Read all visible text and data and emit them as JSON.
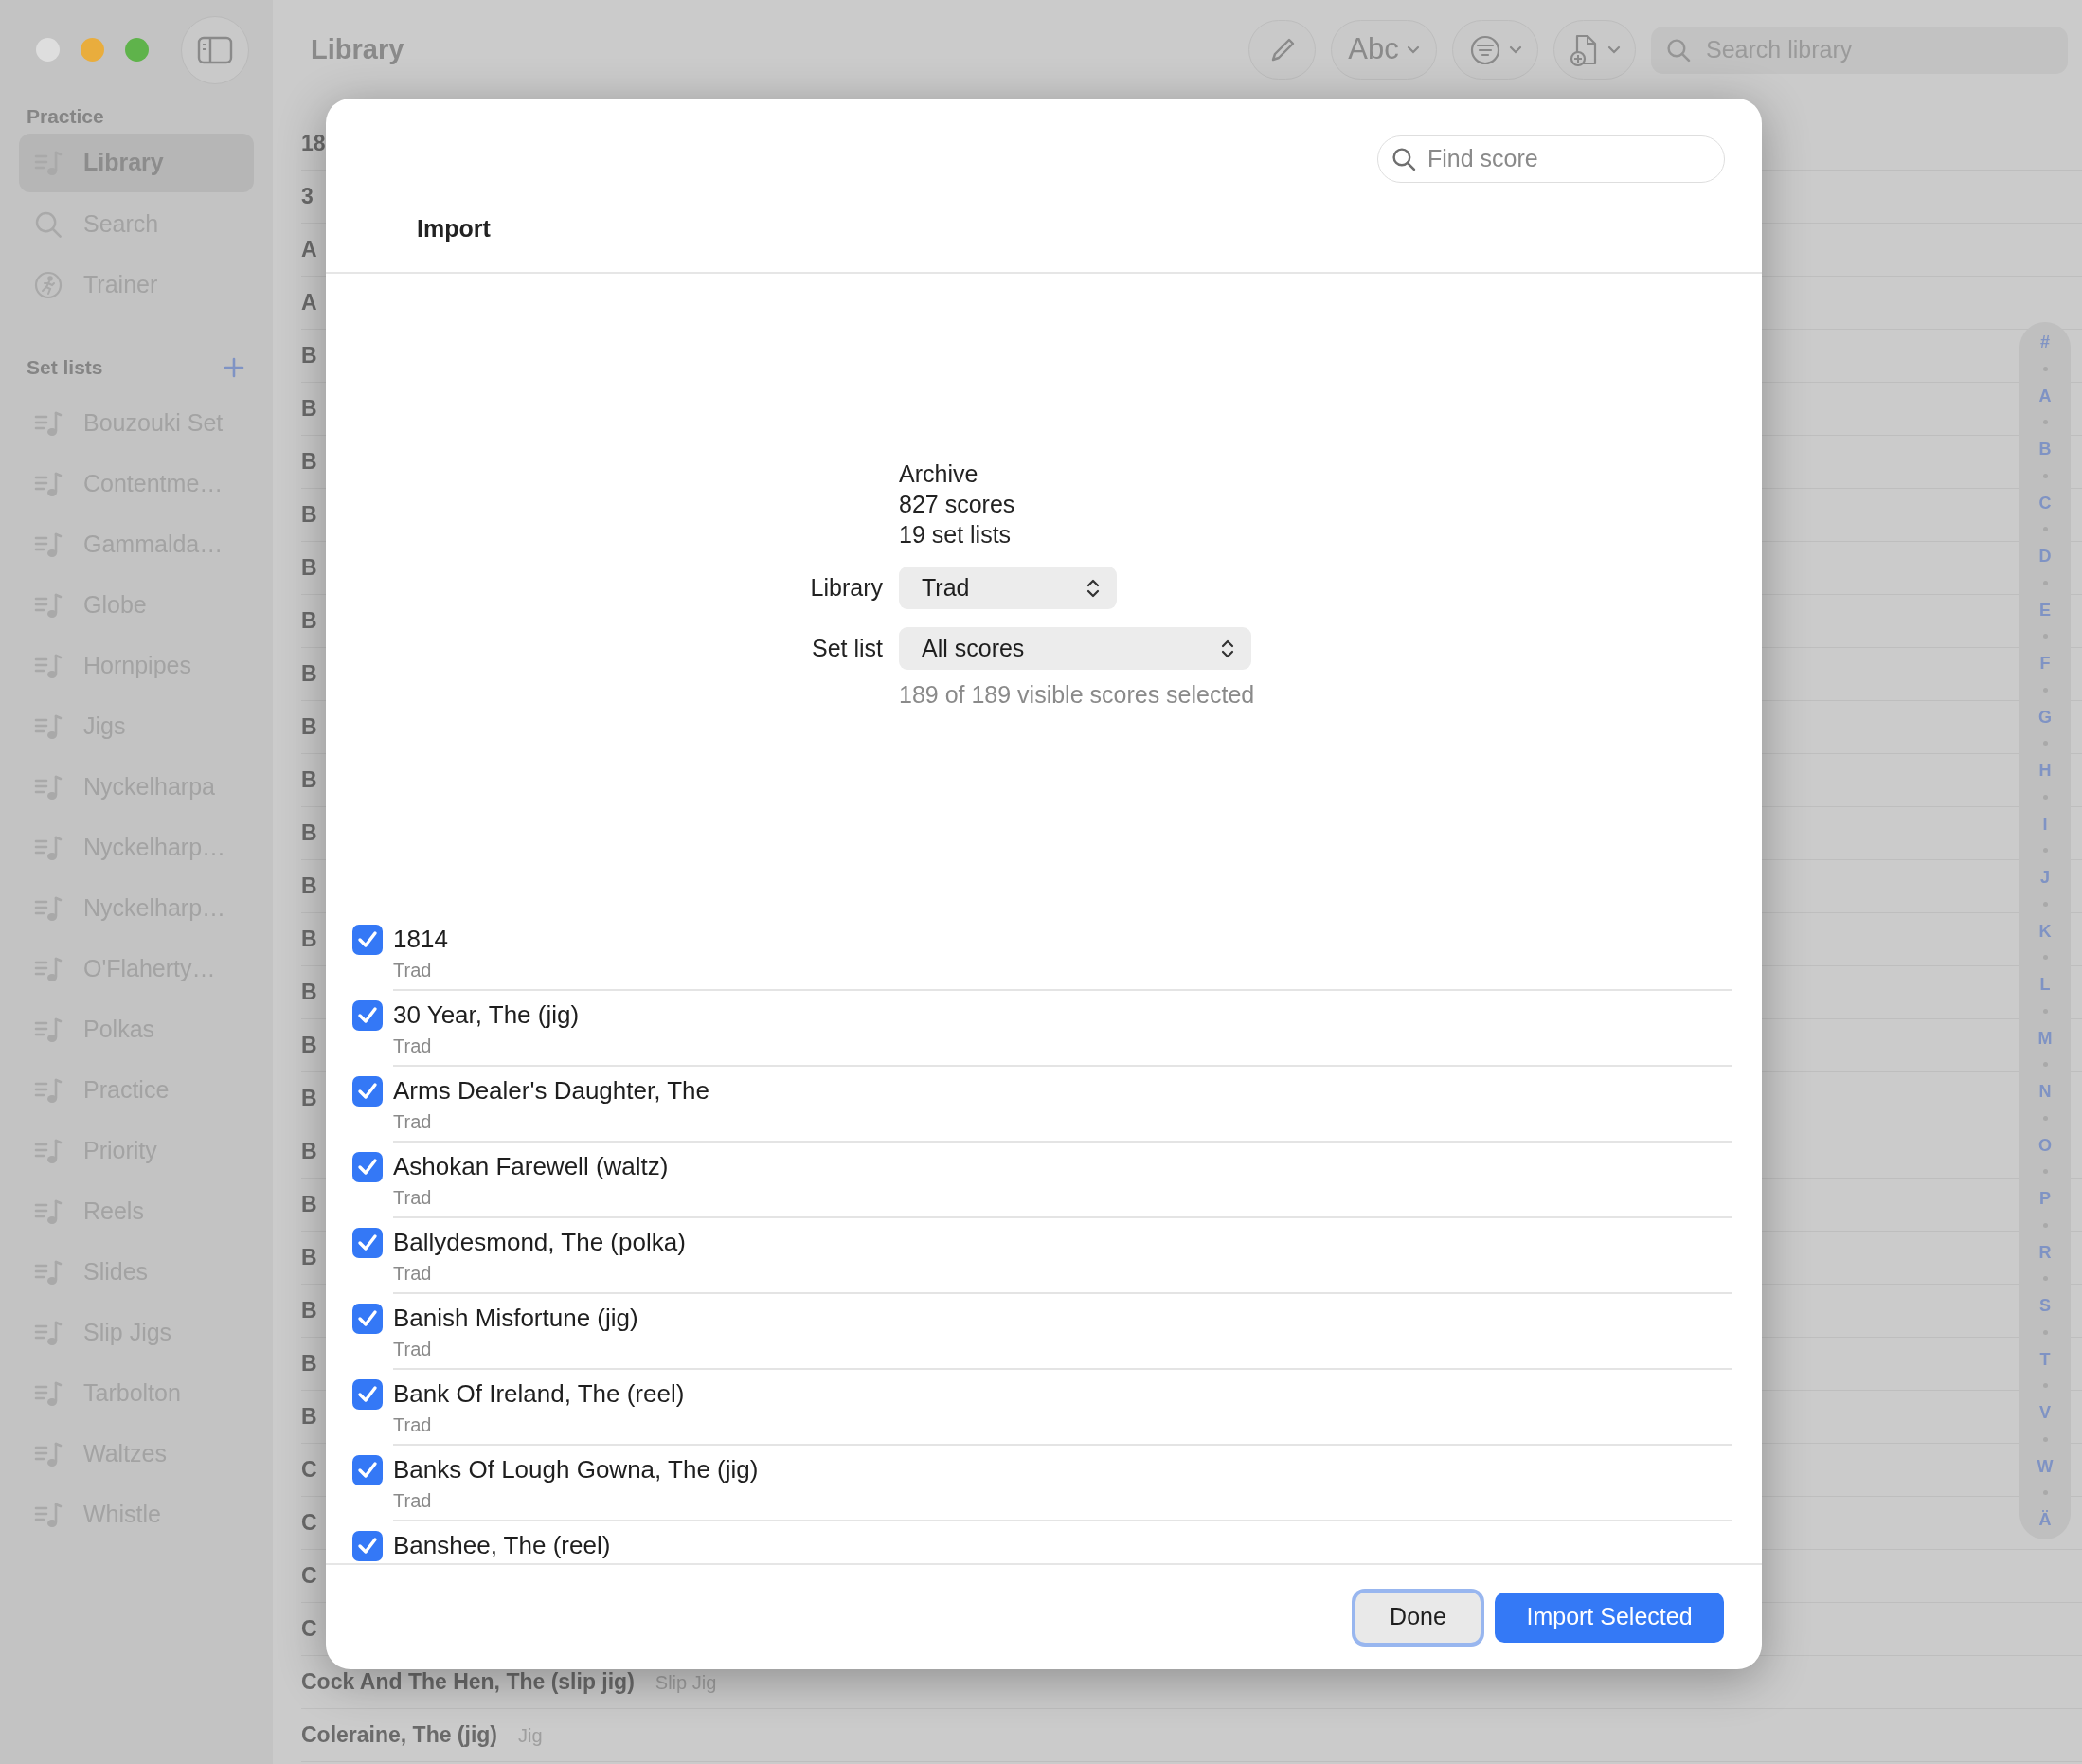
{
  "window": {
    "title": "Library"
  },
  "toolbar": {
    "text_style_button": "Abc",
    "search": {
      "placeholder": "Search library"
    }
  },
  "sidebar": {
    "sections": [
      {
        "title": "Practice",
        "items": [
          {
            "label": "Library",
            "kind": "library",
            "selected": true
          },
          {
            "label": "Search",
            "kind": "search",
            "selected": false
          },
          {
            "label": "Trainer",
            "kind": "trainer",
            "selected": false
          }
        ]
      },
      {
        "title": "Set lists",
        "add_button": true,
        "items": [
          {
            "label": "Bouzouki Set",
            "kind": "setlist",
            "selected": false
          },
          {
            "label": "Contentme…",
            "kind": "setlist",
            "selected": false
          },
          {
            "label": "Gammalda…",
            "kind": "setlist",
            "selected": false
          },
          {
            "label": "Globe",
            "kind": "setlist",
            "selected": false
          },
          {
            "label": "Hornpipes",
            "kind": "setlist",
            "selected": false
          },
          {
            "label": "Jigs",
            "kind": "setlist",
            "selected": false
          },
          {
            "label": "Nyckelharpa",
            "kind": "setlist",
            "selected": false
          },
          {
            "label": "Nyckelharp…",
            "kind": "setlist",
            "selected": false
          },
          {
            "label": "Nyckelharp…",
            "kind": "setlist",
            "selected": false
          },
          {
            "label": "O'Flaherty…",
            "kind": "setlist",
            "selected": false
          },
          {
            "label": "Polkas",
            "kind": "setlist",
            "selected": false
          },
          {
            "label": "Practice",
            "kind": "setlist",
            "selected": false
          },
          {
            "label": "Priority",
            "kind": "setlist",
            "selected": false
          },
          {
            "label": "Reels",
            "kind": "setlist",
            "selected": false
          },
          {
            "label": "Slides",
            "kind": "setlist",
            "selected": false
          },
          {
            "label": "Slip Jigs",
            "kind": "setlist",
            "selected": false
          },
          {
            "label": "Tarbolton",
            "kind": "setlist",
            "selected": false
          },
          {
            "label": "Waltzes",
            "kind": "setlist",
            "selected": false
          },
          {
            "label": "Whistle",
            "kind": "setlist",
            "selected": false
          }
        ]
      }
    ]
  },
  "library_list": {
    "rows": [
      {
        "title": "18"
      },
      {
        "title": "3"
      },
      {
        "title": "A"
      },
      {
        "title": "A"
      },
      {
        "title": "B"
      },
      {
        "title": "B"
      },
      {
        "title": "B"
      },
      {
        "title": "B"
      },
      {
        "title": "B"
      },
      {
        "title": "B"
      },
      {
        "title": "B"
      },
      {
        "title": "B"
      },
      {
        "title": "B"
      },
      {
        "title": "B"
      },
      {
        "title": "B"
      },
      {
        "title": "B"
      },
      {
        "title": "B"
      },
      {
        "title": "B"
      },
      {
        "title": "B"
      },
      {
        "title": "B"
      },
      {
        "title": "B"
      },
      {
        "title": "B"
      },
      {
        "title": "B"
      },
      {
        "title": "B"
      },
      {
        "title": "B"
      },
      {
        "title": "C"
      },
      {
        "title": "C"
      },
      {
        "title": "C"
      },
      {
        "title": "C"
      },
      {
        "title": "Cock And The Hen, The (slip jig)",
        "type": "Slip Jig"
      },
      {
        "title": "Coleraine, The (jig)",
        "type": "Jig"
      }
    ]
  },
  "index_bar": {
    "letters": [
      "#",
      "A",
      "B",
      "C",
      "D",
      "E",
      "F",
      "G",
      "H",
      "I",
      "J",
      "K",
      "L",
      "M",
      "N",
      "O",
      "P",
      "R",
      "S",
      "T",
      "V",
      "W",
      "Ä"
    ]
  },
  "import_sheet": {
    "search": {
      "placeholder": "Find score"
    },
    "title": "Import",
    "summary": [
      "Archive",
      "827 scores",
      "19 set lists"
    ],
    "library": {
      "label": "Library",
      "value": "Trad"
    },
    "set_list": {
      "label": "Set list",
      "value": "All scores"
    },
    "selection_status": "189 of 189 visible scores selected",
    "scores": [
      {
        "title": "1814",
        "library": "Trad",
        "checked": true
      },
      {
        "title": "30 Year, The (jig)",
        "library": "Trad",
        "checked": true
      },
      {
        "title": "Arms Dealer's Daughter, The",
        "library": "Trad",
        "checked": true
      },
      {
        "title": "Ashokan Farewell (waltz)",
        "library": "Trad",
        "checked": true
      },
      {
        "title": "Ballydesmond, The (polka)",
        "library": "Trad",
        "checked": true
      },
      {
        "title": "Banish Misfortune (jig)",
        "library": "Trad",
        "checked": true
      },
      {
        "title": "Bank Of Ireland, The (reel)",
        "library": "Trad",
        "checked": true
      },
      {
        "title": "Banks Of Lough Gowna, The (jig)",
        "library": "Trad",
        "checked": true
      },
      {
        "title": "Banshee, The (reel)",
        "checked": true
      }
    ],
    "buttons": [
      {
        "label": "Done",
        "kind": "secondary",
        "focused": true
      },
      {
        "label": "Import Selected",
        "kind": "primary",
        "focused": false
      }
    ]
  }
}
